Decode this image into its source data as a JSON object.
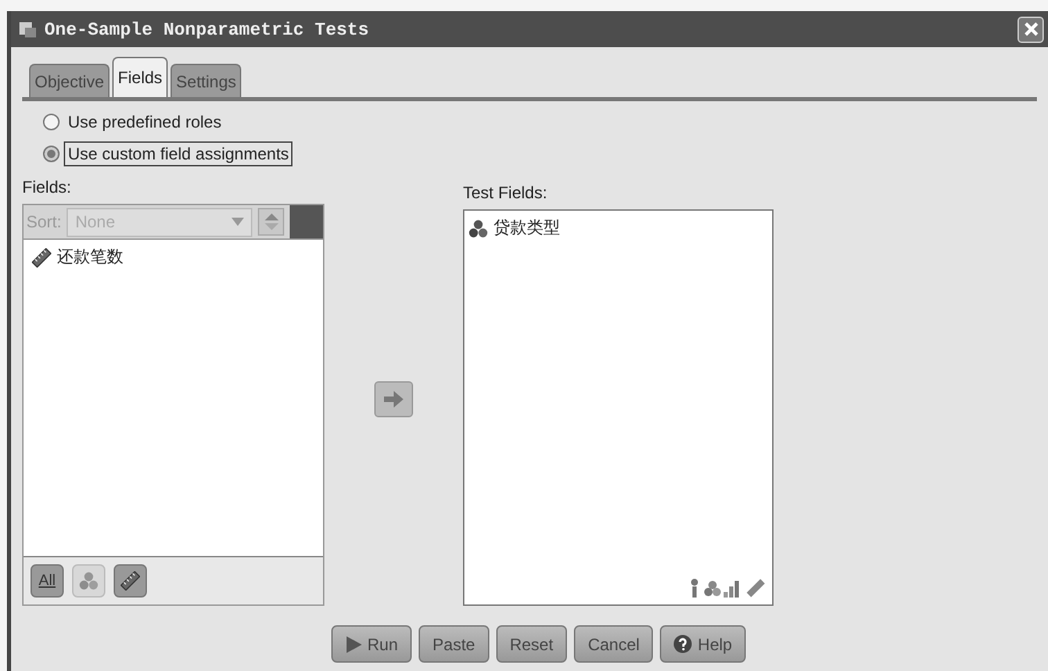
{
  "window": {
    "title": "One-Sample Nonparametric Tests"
  },
  "tabs": [
    {
      "label": "Objective",
      "selected": false
    },
    {
      "label": "Fields",
      "selected": true
    },
    {
      "label": "Settings",
      "selected": false
    }
  ],
  "radios": [
    {
      "label": "Use predefined roles",
      "selected": false,
      "focused": false
    },
    {
      "label": "Use custom field assignments",
      "selected": true,
      "focused": true
    }
  ],
  "fields_panel": {
    "label": "Fields:",
    "sort_label": "Sort:",
    "sort_value": "None",
    "sort_disabled": true,
    "items": [
      {
        "name": "还款笔数",
        "kind": "scale"
      }
    ],
    "filter_buttons": [
      {
        "kind": "all",
        "label": "All",
        "disabled": false
      },
      {
        "kind": "nominal",
        "disabled": true
      },
      {
        "kind": "scale",
        "disabled": false
      }
    ]
  },
  "test_fields": {
    "label": "Test Fields:",
    "items": [
      {
        "name": "贷款类型",
        "kind": "nominal"
      }
    ]
  },
  "buttons": [
    {
      "label": "Run",
      "kind": "run"
    },
    {
      "label": "Paste",
      "kind": "plain"
    },
    {
      "label": "Reset",
      "kind": "plain"
    },
    {
      "label": "Cancel",
      "kind": "plain"
    },
    {
      "label": "Help",
      "kind": "help"
    }
  ]
}
